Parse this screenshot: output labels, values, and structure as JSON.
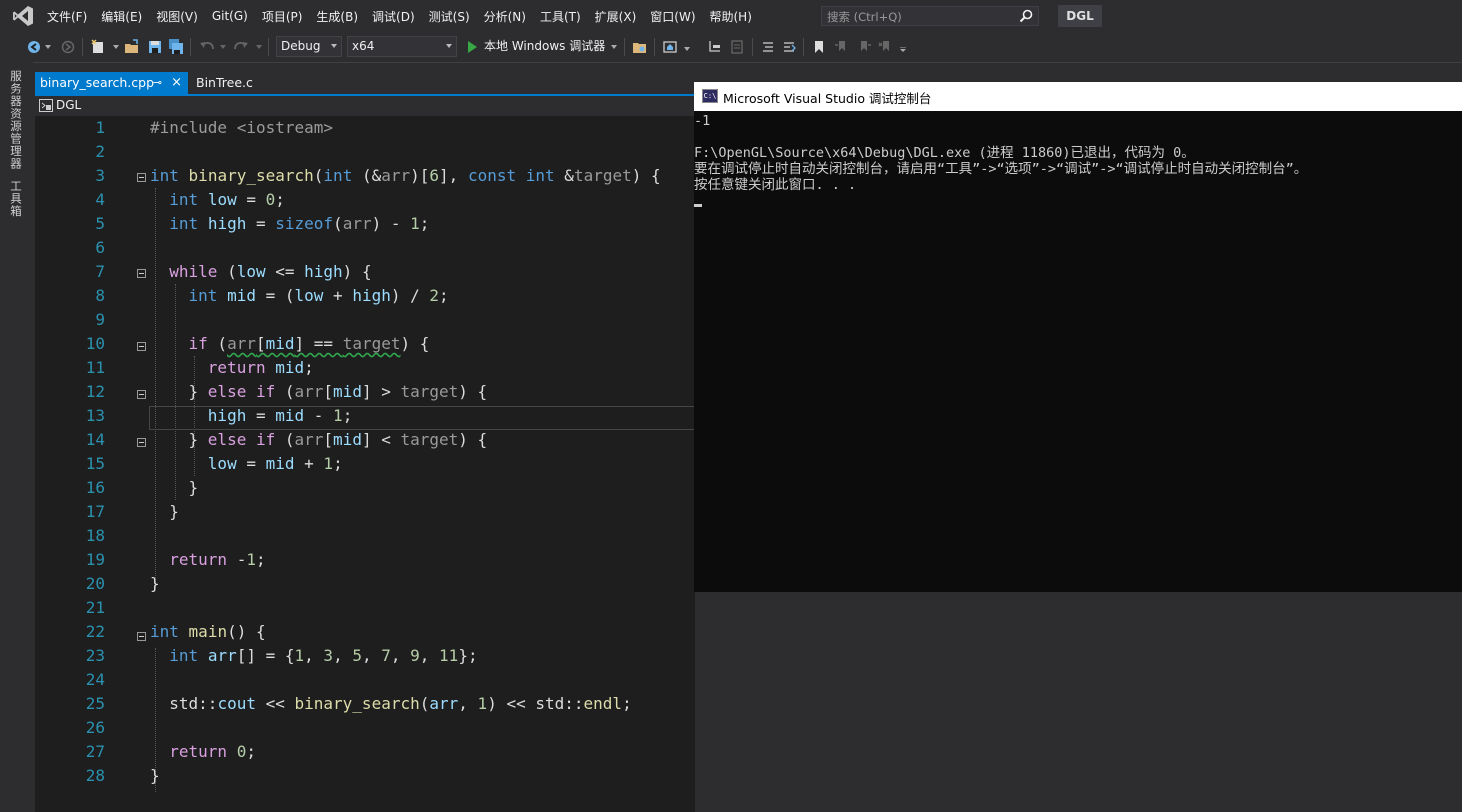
{
  "menubar": {
    "items": [
      "文件(F)",
      "编辑(E)",
      "视图(V)",
      "Git(G)",
      "项目(P)",
      "生成(B)",
      "调试(D)",
      "测试(S)",
      "分析(N)",
      "工具(T)",
      "扩展(X)",
      "窗口(W)",
      "帮助(H)"
    ],
    "search_placeholder": "搜索 (Ctrl+Q)",
    "solution_name": "DGL"
  },
  "toolbar": {
    "configuration": "Debug",
    "platform": "x64",
    "run_label": "本地 Windows 调试器"
  },
  "sidestrip": {
    "server_explorer": "服务器资源管理器",
    "toolbox": "工具箱"
  },
  "tabs": [
    {
      "label": "binary_search.cpp",
      "pin": "⊸",
      "close": "×"
    },
    {
      "label": "BinTree.c"
    }
  ],
  "navbar": {
    "project": "DGL"
  },
  "editor": {
    "line_numbers": [
      "1",
      "2",
      "3",
      "4",
      "5",
      "6",
      "7",
      "8",
      "9",
      "10",
      "11",
      "12",
      "13",
      "14",
      "15",
      "16",
      "17",
      "18",
      "19",
      "20",
      "21",
      "22",
      "23",
      "24",
      "25",
      "26",
      "27",
      "28"
    ],
    "current_line": 13
  },
  "console": {
    "title": "Microsoft Visual Studio 调试控制台",
    "icon_label": "C:\\",
    "lines": [
      "-1",
      "",
      "F:\\OpenGL\\Source\\x64\\Debug\\DGL.exe (进程 11860)已退出，代码为 0。",
      "要在调试停止时自动关闭控制台，请启用“工具”->“选项”->“调试”->“调试停止时自动关闭控制台”。",
      "按任意键关闭此窗口. . ."
    ]
  },
  "colors": {
    "accent": "#007acc",
    "chrome": "#2d2d30",
    "editor_bg": "#1e1e1e",
    "line_number": "#2b91af",
    "keyword": "#569cd6",
    "function": "#dcdcaa",
    "variable": "#9cdcfe",
    "control": "#d8a0df",
    "number": "#b5cea8"
  }
}
